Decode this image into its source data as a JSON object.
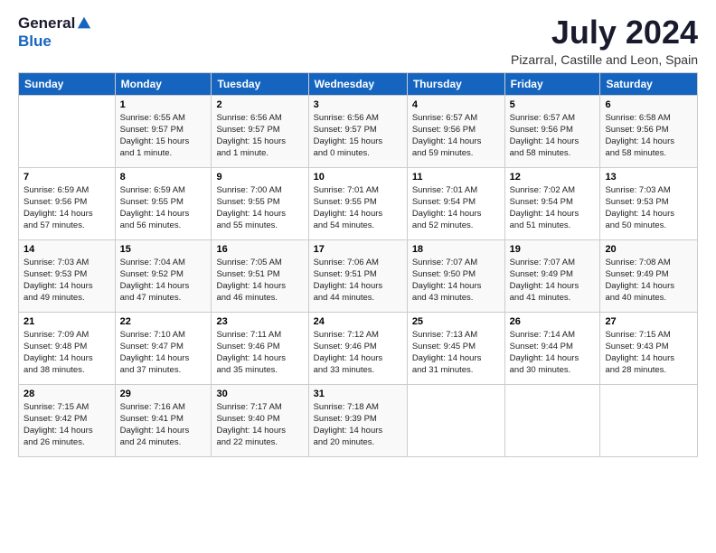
{
  "logo": {
    "line1": "General",
    "line2": "Blue"
  },
  "title": "July 2024",
  "subtitle": "Pizarral, Castille and Leon, Spain",
  "days_of_week": [
    "Sunday",
    "Monday",
    "Tuesday",
    "Wednesday",
    "Thursday",
    "Friday",
    "Saturday"
  ],
  "weeks": [
    [
      {
        "day": "",
        "info": ""
      },
      {
        "day": "1",
        "info": "Sunrise: 6:55 AM\nSunset: 9:57 PM\nDaylight: 15 hours\nand 1 minute."
      },
      {
        "day": "2",
        "info": "Sunrise: 6:56 AM\nSunset: 9:57 PM\nDaylight: 15 hours\nand 1 minute."
      },
      {
        "day": "3",
        "info": "Sunrise: 6:56 AM\nSunset: 9:57 PM\nDaylight: 15 hours\nand 0 minutes."
      },
      {
        "day": "4",
        "info": "Sunrise: 6:57 AM\nSunset: 9:56 PM\nDaylight: 14 hours\nand 59 minutes."
      },
      {
        "day": "5",
        "info": "Sunrise: 6:57 AM\nSunset: 9:56 PM\nDaylight: 14 hours\nand 58 minutes."
      },
      {
        "day": "6",
        "info": "Sunrise: 6:58 AM\nSunset: 9:56 PM\nDaylight: 14 hours\nand 58 minutes."
      }
    ],
    [
      {
        "day": "7",
        "info": "Sunrise: 6:59 AM\nSunset: 9:56 PM\nDaylight: 14 hours\nand 57 minutes."
      },
      {
        "day": "8",
        "info": "Sunrise: 6:59 AM\nSunset: 9:55 PM\nDaylight: 14 hours\nand 56 minutes."
      },
      {
        "day": "9",
        "info": "Sunrise: 7:00 AM\nSunset: 9:55 PM\nDaylight: 14 hours\nand 55 minutes."
      },
      {
        "day": "10",
        "info": "Sunrise: 7:01 AM\nSunset: 9:55 PM\nDaylight: 14 hours\nand 54 minutes."
      },
      {
        "day": "11",
        "info": "Sunrise: 7:01 AM\nSunset: 9:54 PM\nDaylight: 14 hours\nand 52 minutes."
      },
      {
        "day": "12",
        "info": "Sunrise: 7:02 AM\nSunset: 9:54 PM\nDaylight: 14 hours\nand 51 minutes."
      },
      {
        "day": "13",
        "info": "Sunrise: 7:03 AM\nSunset: 9:53 PM\nDaylight: 14 hours\nand 50 minutes."
      }
    ],
    [
      {
        "day": "14",
        "info": "Sunrise: 7:03 AM\nSunset: 9:53 PM\nDaylight: 14 hours\nand 49 minutes."
      },
      {
        "day": "15",
        "info": "Sunrise: 7:04 AM\nSunset: 9:52 PM\nDaylight: 14 hours\nand 47 minutes."
      },
      {
        "day": "16",
        "info": "Sunrise: 7:05 AM\nSunset: 9:51 PM\nDaylight: 14 hours\nand 46 minutes."
      },
      {
        "day": "17",
        "info": "Sunrise: 7:06 AM\nSunset: 9:51 PM\nDaylight: 14 hours\nand 44 minutes."
      },
      {
        "day": "18",
        "info": "Sunrise: 7:07 AM\nSunset: 9:50 PM\nDaylight: 14 hours\nand 43 minutes."
      },
      {
        "day": "19",
        "info": "Sunrise: 7:07 AM\nSunset: 9:49 PM\nDaylight: 14 hours\nand 41 minutes."
      },
      {
        "day": "20",
        "info": "Sunrise: 7:08 AM\nSunset: 9:49 PM\nDaylight: 14 hours\nand 40 minutes."
      }
    ],
    [
      {
        "day": "21",
        "info": "Sunrise: 7:09 AM\nSunset: 9:48 PM\nDaylight: 14 hours\nand 38 minutes."
      },
      {
        "day": "22",
        "info": "Sunrise: 7:10 AM\nSunset: 9:47 PM\nDaylight: 14 hours\nand 37 minutes."
      },
      {
        "day": "23",
        "info": "Sunrise: 7:11 AM\nSunset: 9:46 PM\nDaylight: 14 hours\nand 35 minutes."
      },
      {
        "day": "24",
        "info": "Sunrise: 7:12 AM\nSunset: 9:46 PM\nDaylight: 14 hours\nand 33 minutes."
      },
      {
        "day": "25",
        "info": "Sunrise: 7:13 AM\nSunset: 9:45 PM\nDaylight: 14 hours\nand 31 minutes."
      },
      {
        "day": "26",
        "info": "Sunrise: 7:14 AM\nSunset: 9:44 PM\nDaylight: 14 hours\nand 30 minutes."
      },
      {
        "day": "27",
        "info": "Sunrise: 7:15 AM\nSunset: 9:43 PM\nDaylight: 14 hours\nand 28 minutes."
      }
    ],
    [
      {
        "day": "28",
        "info": "Sunrise: 7:15 AM\nSunset: 9:42 PM\nDaylight: 14 hours\nand 26 minutes."
      },
      {
        "day": "29",
        "info": "Sunrise: 7:16 AM\nSunset: 9:41 PM\nDaylight: 14 hours\nand 24 minutes."
      },
      {
        "day": "30",
        "info": "Sunrise: 7:17 AM\nSunset: 9:40 PM\nDaylight: 14 hours\nand 22 minutes."
      },
      {
        "day": "31",
        "info": "Sunrise: 7:18 AM\nSunset: 9:39 PM\nDaylight: 14 hours\nand 20 minutes."
      },
      {
        "day": "",
        "info": ""
      },
      {
        "day": "",
        "info": ""
      },
      {
        "day": "",
        "info": ""
      }
    ]
  ]
}
